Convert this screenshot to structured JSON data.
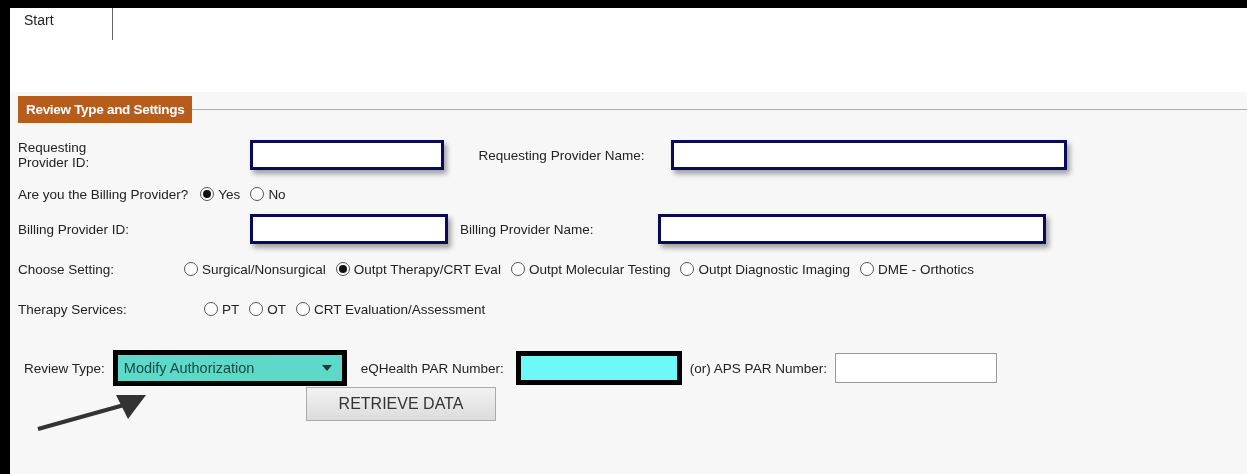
{
  "tabs": [
    {
      "label": "Start"
    }
  ],
  "section": {
    "title": "Review Type and Settings"
  },
  "requesting_provider": {
    "id_label": "Requesting Provider ID:",
    "name_label": "Requesting Provider Name:"
  },
  "billing_question": {
    "label": "Are you the Billing Provider?",
    "options": [
      {
        "label": "Yes",
        "selected": true
      },
      {
        "label": "No",
        "selected": false
      }
    ]
  },
  "billing_provider": {
    "id_label": "Billing Provider ID:",
    "name_label": "Billing Provider Name:"
  },
  "setting": {
    "label": "Choose Setting:",
    "options": [
      {
        "label": "Surgical/Nonsurgical",
        "selected": false
      },
      {
        "label": "Outpt Therapy/CRT Eval",
        "selected": true
      },
      {
        "label": "Outpt Molecular Testing",
        "selected": false
      },
      {
        "label": "Outpt Diagnostic Imaging",
        "selected": false
      },
      {
        "label": "DME - Orthotics",
        "selected": false
      }
    ]
  },
  "therapy_services": {
    "label": "Therapy Services:",
    "options": [
      {
        "label": "PT",
        "selected": false
      },
      {
        "label": "OT",
        "selected": false
      },
      {
        "label": "CRT Evaluation/Assessment",
        "selected": false
      }
    ]
  },
  "review_type": {
    "label": "Review Type:",
    "value": "Modify Authorization"
  },
  "eqhealth_par": {
    "label": "eQHealth PAR Number:"
  },
  "aps_par": {
    "label": "(or) APS PAR Number:"
  },
  "retrieve_button": {
    "label": "RETRIEVE DATA"
  }
}
